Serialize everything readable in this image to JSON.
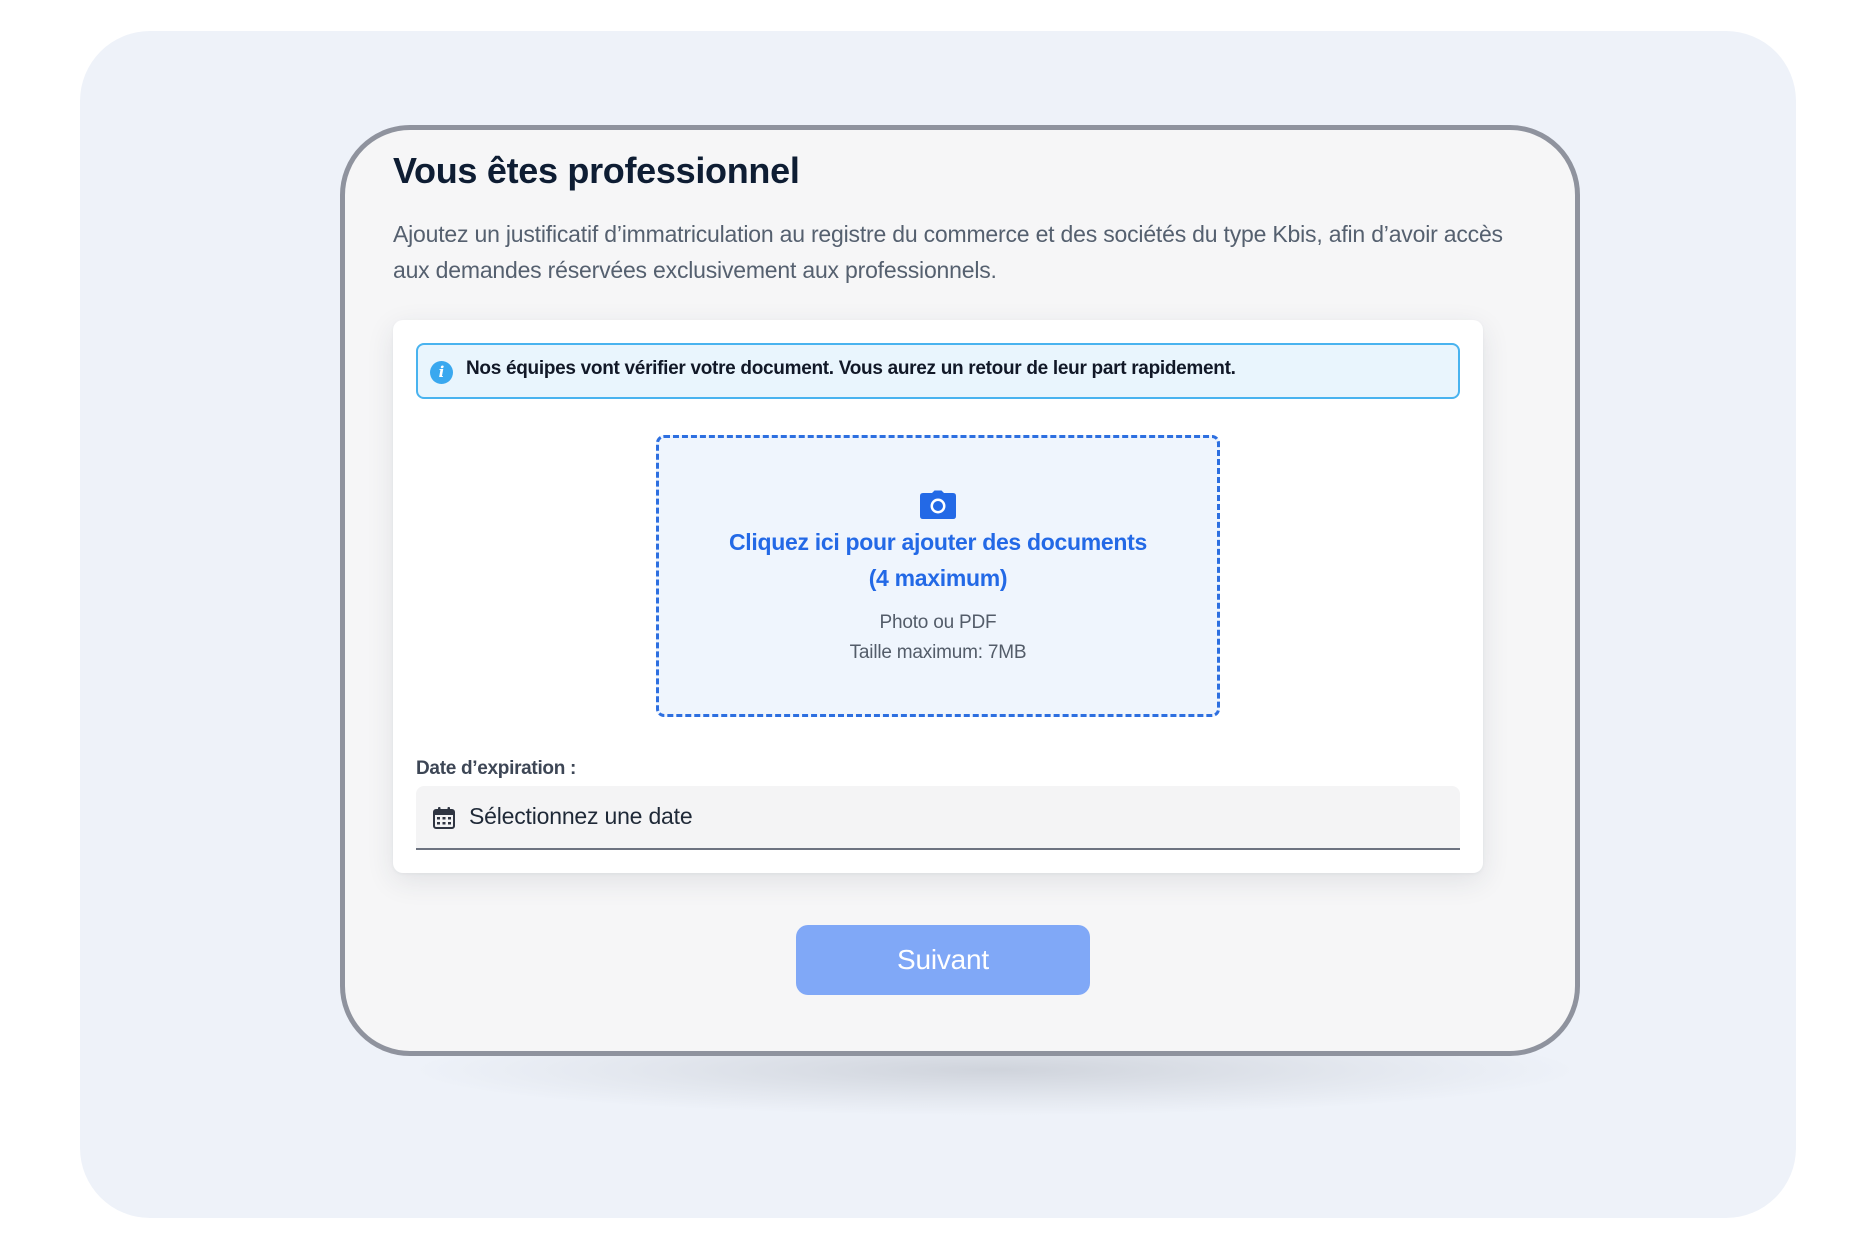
{
  "page": {
    "title": "Vous êtes professionnel",
    "description": "Ajoutez un justificatif d’immatriculation au registre du commerce et des sociétés du type Kbis, afin d’avoir accès aux demandes réservées exclusivement aux professionnels."
  },
  "info_alert": {
    "icon": "info-icon",
    "text": "Nos équipes vont vérifier votre document. Vous aurez un retour de leur part rapidement."
  },
  "upload": {
    "icon": "camera-icon",
    "title_line1": "Cliquez ici pour ajouter des documents",
    "title_line2": "(4 maximum)",
    "hint_line1": "Photo ou PDF",
    "hint_line2": "Taille maximum: 7MB"
  },
  "expiration_date": {
    "label": "Date d’expiration :",
    "icon": "calendar-icon",
    "placeholder": "Sélectionnez une date"
  },
  "next_button": {
    "label": "Suivant"
  },
  "colors": {
    "backdrop": "#eef2f9",
    "device_frame": "#8f939e",
    "title": "#0e1d33",
    "accent_blue": "#2369e6",
    "info_border": "#49b3ef",
    "info_background": "#e9f5fd",
    "button_disabled": "#80a8f7"
  }
}
